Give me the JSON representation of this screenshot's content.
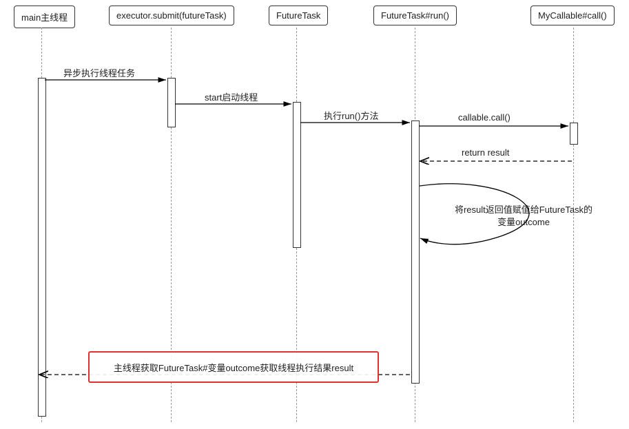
{
  "participants": {
    "p1": "main主线程",
    "p2": "executor.submit(futureTask)",
    "p3": "FutureTask",
    "p4": "FutureTask#run()",
    "p5": "MyCallable#call()"
  },
  "messages": {
    "m1": "异步执行线程任务",
    "m2": "start启动线程",
    "m3": "执行run()方法",
    "m4": "callable.call()",
    "m5": "return  result",
    "m6_line1": "将result返回值赋值给FutureTask的",
    "m6_line2": "变量outcome",
    "m7": "主线程获取FutureTask#变量outcome获取线程执行结果result"
  },
  "colors": {
    "highlight_border": "#e03030",
    "box_border": "#333333",
    "lifeline": "#999999"
  }
}
